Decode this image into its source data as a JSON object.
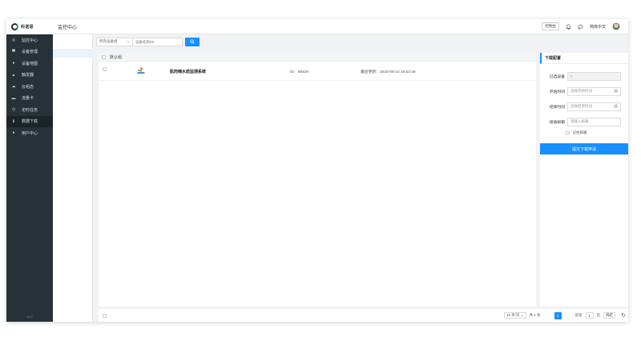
{
  "header": {
    "logo_text": "科诺思",
    "page_title": "监控中心",
    "console_label": "控制台",
    "language": "简体中文",
    "icons": [
      "bell-icon",
      "message-icon",
      "user-avatar"
    ]
  },
  "sidebar": {
    "items": [
      {
        "label": "监控中心",
        "icon": "monitor-icon"
      },
      {
        "label": "设备管理",
        "icon": "device-icon"
      },
      {
        "label": "设备地图",
        "icon": "map-pin-icon"
      },
      {
        "label": "触发器",
        "icon": "bell-icon"
      },
      {
        "label": "云组态",
        "icon": "cloud-icon"
      },
      {
        "label": "流量卡",
        "icon": "card-icon"
      },
      {
        "label": "定时任务",
        "icon": "clock-icon"
      },
      {
        "label": "数据下载",
        "icon": "download-icon"
      },
      {
        "label": "用户中心",
        "icon": "user-icon"
      }
    ],
    "version": "v2.2"
  },
  "toolbar": {
    "device_select": "所有设备组",
    "search_placeholder": "设备名称/ID"
  },
  "device_list": {
    "group_label": "默认组",
    "devices": [
      {
        "name": "肌肉楠水质监测系统",
        "id_text": "ID：69429",
        "updated_text": "最后更新：2020-06-10 16:54:49"
      }
    ]
  },
  "pagination": {
    "page_size": "10 条/页",
    "total": "共 1 条",
    "prev": "‹",
    "current_page": "1",
    "next": "›",
    "goto_label": "前往",
    "goto_value": "1",
    "page_suffix": "页",
    "confirm": "确定"
  },
  "download_panel": {
    "title": "下载配置",
    "selected_label": "已选设备",
    "selected_value": "0",
    "start_label": "开始时间",
    "start_placeholder": "选择开始时间",
    "end_label": "结束时间",
    "end_placeholder": "选择结束时间",
    "email_label": "接收邮箱",
    "email_placeholder": "请输入邮箱",
    "remember_label": "记住邮箱",
    "submit_label": "提交下载申请"
  },
  "colors": {
    "primary": "#1890ff",
    "sidebar_bg": "#263238"
  }
}
